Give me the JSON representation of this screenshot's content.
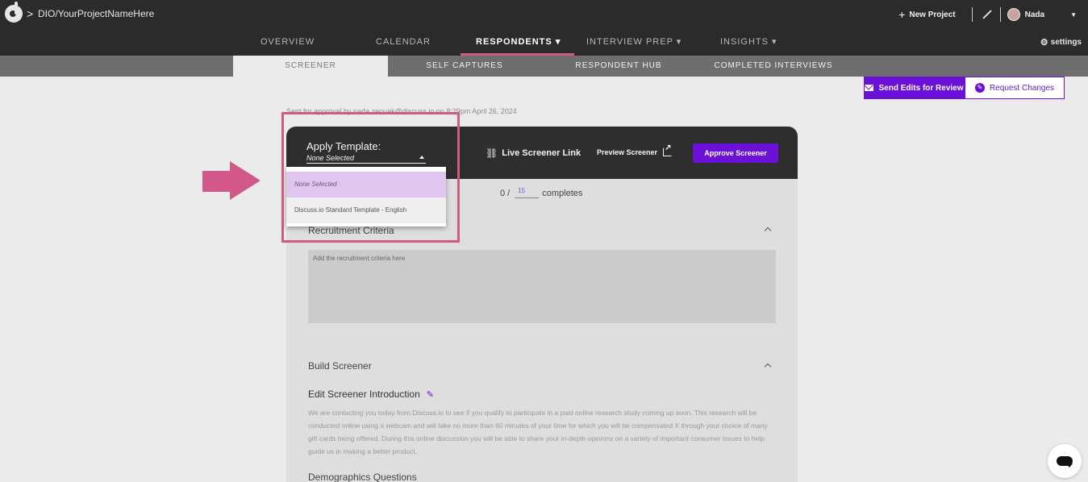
{
  "header": {
    "project_name": "DIO/YourProjectNameHere",
    "new_project_label": "New Project",
    "user_name": "Nada",
    "settings_label": "settings"
  },
  "main_nav": {
    "overview": "OVERVIEW",
    "calendar": "CALENDAR",
    "respondents": "RESPONDENTS",
    "interview_prep": "INTERVIEW PREP",
    "insights": "INSIGHTS"
  },
  "sub_nav": {
    "screener": "SCREENER",
    "self_captures": "SELF CAPTURES",
    "respondent_hub": "RESPONDENT HUB",
    "completed_interviews": "COMPLETED INTERVIEWS"
  },
  "actions": {
    "send_edits": "Send Edits for Review",
    "request_changes": "Request Changes"
  },
  "sent_note": "Sent for approval by nada.zeouak@discuss.io on 8:29pm April 26, 2024",
  "screener_header": {
    "apply_template_label": "Apply Template:",
    "template_value": "None Selected",
    "live_link": "Live Screener Link",
    "preview": "Preview Screener",
    "approve": "Approve Screener"
  },
  "completes": {
    "current": "0 /",
    "target": "15",
    "label": "completes"
  },
  "dropdown": {
    "options": [
      "None Selected",
      "Discuss.io Standard Template - English"
    ]
  },
  "sections": {
    "recruitment_title": "Recruitment Criteria",
    "recruitment_placeholder": "Add the recruitment criteria here",
    "build_title": "Build Screener",
    "intro_title": "Edit Screener Introduction",
    "intro_body": "We are contacting you today from Discuss.io to see if you qualify to participate in a paid online research study coming up soon. This research will be conducted online using a webcam and will take no more than 60 minutes of your time for which you will be compensated X through your choice of many gift cards being offered. During this online discussion you will be able to share your in-depth opinions on a variety of important consumer issues to help guide us in making a better product.",
    "demographics_title": "Demographics Questions"
  },
  "colors": {
    "accent": "#6a10d8",
    "highlight": "#d2588a",
    "topbar": "#2b2b2b"
  }
}
